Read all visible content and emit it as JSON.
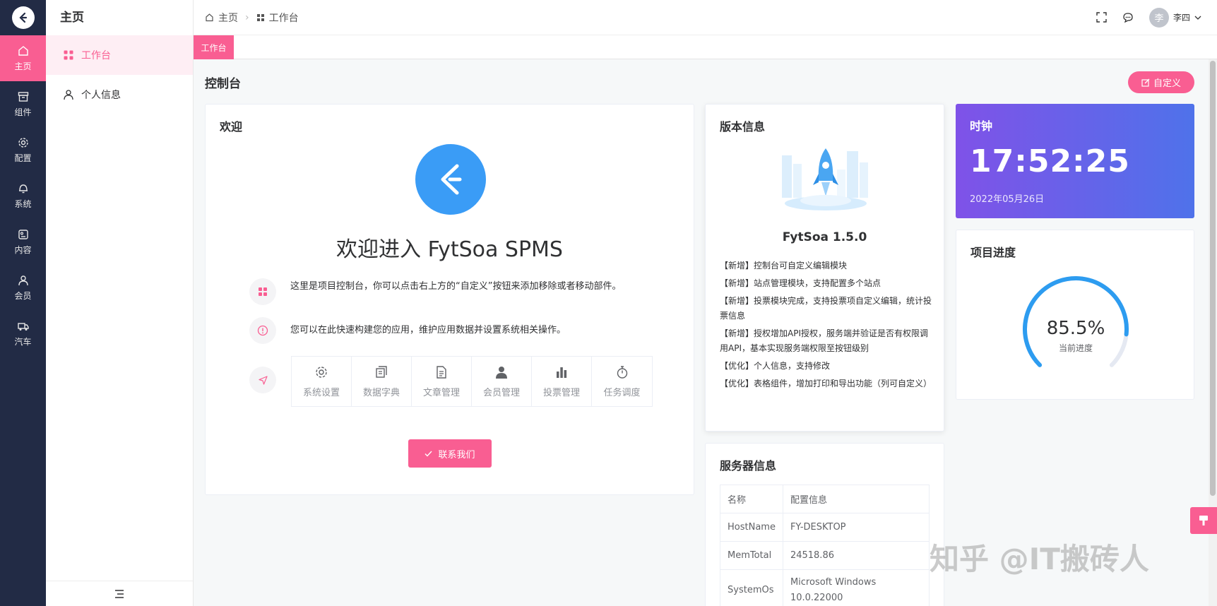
{
  "rail": {
    "items": [
      {
        "label": "主页",
        "icon": "home-icon"
      },
      {
        "label": "组件",
        "icon": "box-icon"
      },
      {
        "label": "配置",
        "icon": "gear-icon"
      },
      {
        "label": "系统",
        "icon": "bell-icon"
      },
      {
        "label": "内容",
        "icon": "content-icon"
      },
      {
        "label": "会员",
        "icon": "user-icon"
      },
      {
        "label": "汽车",
        "icon": "truck-icon"
      }
    ]
  },
  "sidebar": {
    "title": "主页",
    "items": [
      {
        "label": "工作台",
        "icon": "grid-icon"
      },
      {
        "label": "个人信息",
        "icon": "user-icon"
      }
    ]
  },
  "header": {
    "breadcrumb": [
      "主页",
      "工作台"
    ],
    "avatar_text": "李",
    "user_name": "李四"
  },
  "tagbar": {
    "active_tag": "工作台"
  },
  "main": {
    "title": "控制台",
    "custom_button": "自定义"
  },
  "welcome": {
    "title": "欢迎",
    "heading": "欢迎进入 FytSoa SPMS",
    "tips": [
      "这里是项目控制台，你可以点击右上方的“自定义”按钮来添加移除或者移动部件。",
      "您可以在此快速构建您的应用，维护应用数据并设置系统相关操作。"
    ],
    "shortcuts": [
      {
        "label": "系统设置",
        "icon": "gear-icon"
      },
      {
        "label": "数据字典",
        "icon": "dictionary-icon"
      },
      {
        "label": "文章管理",
        "icon": "document-icon"
      },
      {
        "label": "会员管理",
        "icon": "member-icon"
      },
      {
        "label": "投票管理",
        "icon": "bar-chart-icon"
      },
      {
        "label": "任务调度",
        "icon": "stopwatch-icon"
      }
    ],
    "contact_button": "联系我们"
  },
  "version": {
    "title": "版本信息",
    "name": "FytSoa 1.5.0",
    "notes": [
      "【新增】控制台可自定义编辑模块",
      "【新增】站点管理模块，支持配置多个站点",
      "【新增】投票模块完成，支持投票项自定义编辑，统计投票信息",
      "【新增】授权增加API授权，服务端并验证是否有权限调用API，基本实现服务端权限至按钮级别",
      "【优化】个人信息，支持修改",
      "【优化】表格组件，增加打印和导出功能（列可自定义）"
    ]
  },
  "server": {
    "title": "服务器信息",
    "columns": [
      "名称",
      "配置信息"
    ],
    "rows": [
      [
        "HostName",
        "FY-DESKTOP"
      ],
      [
        "MemTotal",
        "24518.86"
      ],
      [
        "SystemOs",
        "Microsoft Windows 10.0.22000"
      ]
    ]
  },
  "clock": {
    "title": "时钟",
    "time": "17:52:25",
    "date": "2022年05月26日"
  },
  "progress": {
    "title": "项目进度",
    "percent": 85.5,
    "percent_text": "85.5%",
    "label": "当前进度",
    "track_color": "#e5e9f2",
    "bar_color": "#2d9cf0"
  },
  "watermark": "知乎 @IT搬砖人",
  "colors": {
    "accent": "#f95e92",
    "rail": "#222b45"
  }
}
